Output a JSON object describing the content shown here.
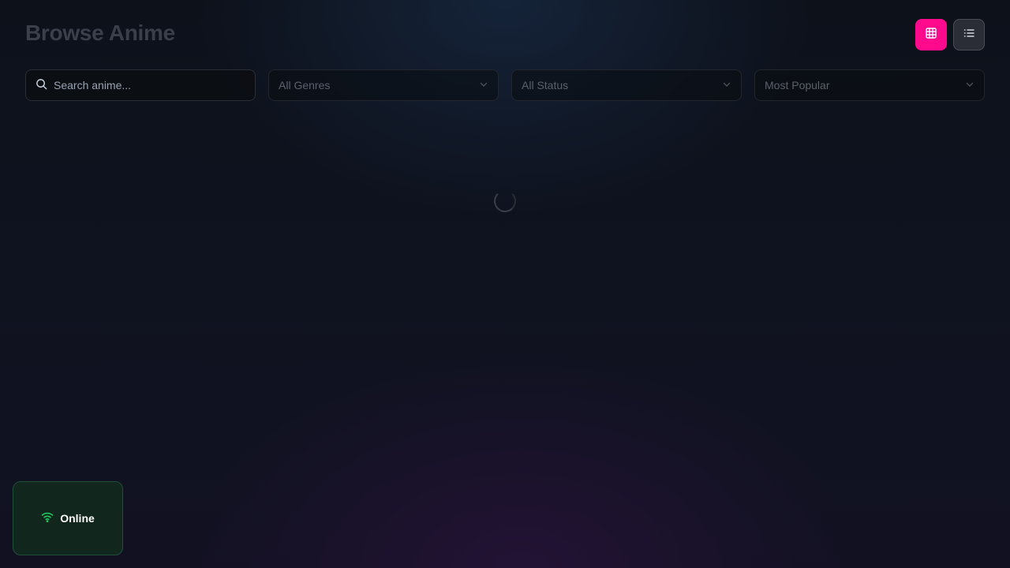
{
  "header": {
    "title": "Browse Anime"
  },
  "view_toggle": {
    "grid_icon": "grid-icon",
    "list_icon": "list-icon",
    "active": "grid",
    "accent_color": "#ff0a8c"
  },
  "filters": {
    "search_placeholder": "Search anime...",
    "search_value": "",
    "genre_selected": "All Genres",
    "status_selected": "All Status",
    "sort_selected": "Most Popular"
  },
  "loading": {
    "icon": "loading-spinner-icon"
  },
  "connection": {
    "status": "Online",
    "icon": "wifi-icon",
    "color": "#22c55e"
  }
}
